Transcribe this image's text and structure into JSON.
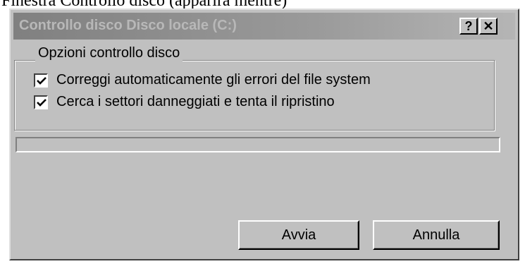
{
  "document": {
    "text_above": "Finestra Controllo disco (apparirà mentre)"
  },
  "window": {
    "title": "Controllo disco Disco locale (C:)",
    "help_button": "?",
    "close_button": "✕"
  },
  "group": {
    "label": "Opzioni controllo disco",
    "options": [
      {
        "label": "Correggi automaticamente gli errori del file system",
        "checked": true
      },
      {
        "label": "Cerca i settori danneggiati e tenta il ripristino",
        "checked": true
      }
    ]
  },
  "progress": {
    "value": 0
  },
  "buttons": {
    "start": "Avvia",
    "cancel": "Annulla"
  },
  "colors": {
    "face": "#c0c0c0",
    "title_gradient_start": "#808080",
    "title_text": "#b8b8b8"
  }
}
